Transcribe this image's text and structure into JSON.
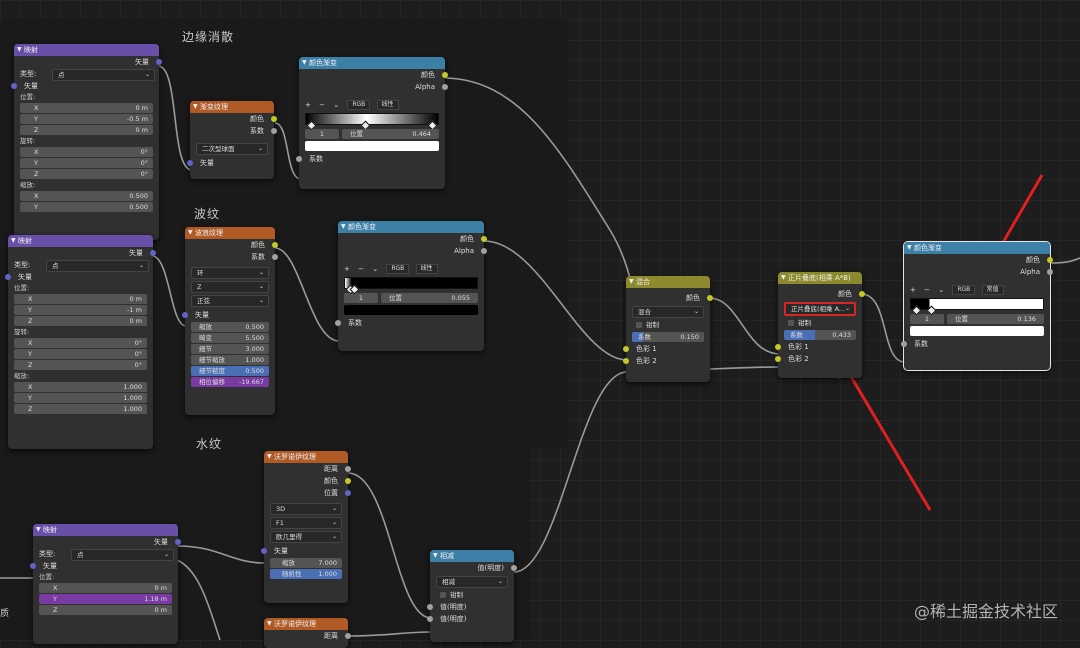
{
  "frames": [
    {
      "title": "边缘消散"
    },
    {
      "title": "波纹"
    },
    {
      "title": "水纹"
    }
  ],
  "nodes": {
    "mapping1": {
      "title": "映射",
      "out_vector": "矢量",
      "type_label": "类型:",
      "type_value": "点",
      "in_vector": "矢量",
      "loc_label": "位置:",
      "loc": [
        {
          "axis": "X",
          "value": "0 m"
        },
        {
          "axis": "Y",
          "value": "-0.5 m"
        },
        {
          "axis": "Z",
          "value": "0 m"
        }
      ],
      "rot_label": "旋转:",
      "rot": [
        {
          "axis": "X",
          "value": "0°"
        },
        {
          "axis": "Y",
          "value": "0°"
        },
        {
          "axis": "Z",
          "value": "0°"
        }
      ],
      "scale_label": "缩放:",
      "scale": [
        {
          "axis": "X",
          "value": "0.500"
        },
        {
          "axis": "Y",
          "value": "0.500"
        }
      ]
    },
    "mapping2": {
      "title": "映射",
      "out_vector": "矢量",
      "type_label": "类型:",
      "type_value": "点",
      "in_vector": "矢量",
      "loc_label": "位置:",
      "loc": [
        {
          "axis": "X",
          "value": "0 m"
        },
        {
          "axis": "Y",
          "value": "-1 m"
        },
        {
          "axis": "Z",
          "value": "0 m"
        }
      ],
      "rot_label": "旋转:",
      "rot": [
        {
          "axis": "X",
          "value": "0°"
        },
        {
          "axis": "Y",
          "value": "0°"
        },
        {
          "axis": "Z",
          "value": "0°"
        }
      ],
      "scale_label": "缩放:",
      "scale": [
        {
          "axis": "X",
          "value": "1.000"
        },
        {
          "axis": "Y",
          "value": "1.000"
        },
        {
          "axis": "Z",
          "value": "1.000"
        }
      ]
    },
    "mapping3": {
      "title": "映射",
      "out_vector": "矢量",
      "type_label": "类型:",
      "type_value": "点",
      "in_vector": "矢量",
      "loc_label": "位置:",
      "loc": [
        {
          "axis": "X",
          "value": "0 m"
        },
        {
          "axis": "Y",
          "value": "1.18 m"
        },
        {
          "axis": "Z",
          "value": "0 m"
        }
      ],
      "left_text": "质"
    },
    "gradient": {
      "title": "渐变纹理",
      "out_color": "颜色",
      "out_factor": "系数",
      "mode": "二次型球面",
      "in_vector": "矢量"
    },
    "ramp1": {
      "title": "颜色渐变",
      "out_color": "颜色",
      "out_alpha": "Alpha",
      "plus": "+",
      "minus": "−",
      "chev": "⌄",
      "color_mode": "RGB",
      "interp": "线性",
      "index": "1",
      "pos_label": "位置",
      "pos_value": "0.464",
      "in_factor": "系数"
    },
    "wave": {
      "title": "波浪纹理",
      "out_color": "颜色",
      "out_factor": "系数",
      "type": "环",
      "axis": "Z",
      "profile": "正弦",
      "in_vector": "矢量",
      "fields": [
        {
          "label": "缩放",
          "value": "0.500"
        },
        {
          "label": "畸变",
          "value": "5.500"
        },
        {
          "label": "细节",
          "value": "3.000"
        },
        {
          "label": "细节缩放",
          "value": "1.000"
        },
        {
          "label": "细节糙度",
          "value": "0.500"
        },
        {
          "label": "相位偏移",
          "value": "-19.667"
        }
      ]
    },
    "ramp2": {
      "title": "颜色渐变",
      "out_color": "颜色",
      "out_alpha": "Alpha",
      "plus": "+",
      "minus": "−",
      "chev": "⌄",
      "color_mode": "RGB",
      "interp": "线性",
      "index": "1",
      "pos_label": "位置",
      "pos_value": "0.055",
      "in_factor": "系数"
    },
    "voronoi1": {
      "title": "沃罗诺伊纹理",
      "out_distance": "距离",
      "out_color": "颜色",
      "out_position": "位置",
      "dim": "3D",
      "feature": "F1",
      "metric": "欧几里得",
      "in_vector": "矢量",
      "fields": [
        {
          "label": "缩放",
          "value": "7.000"
        },
        {
          "label": "随机性",
          "value": "1.000"
        }
      ]
    },
    "voronoi2": {
      "title": "沃罗诺伊纹理",
      "out_distance": "距离"
    },
    "subtract": {
      "title": "相减",
      "out_value": "值(明度)",
      "op": "相减",
      "clamp": "钳制",
      "in1": "值(明度)",
      "in2": "值(明度)"
    },
    "mix1": {
      "title": "混合",
      "out_color": "颜色",
      "blend": "混合",
      "clamp": "钳制",
      "factor_label": "系数",
      "factor_value": "0.150",
      "in_color1": "色彩 1",
      "in_color2": "色彩 2"
    },
    "mix2": {
      "title": "正片叠底(相乘 A*B)",
      "out_color": "颜色",
      "blend": "正片叠底(相乘 A...",
      "clamp": "钳制",
      "factor_label": "系数",
      "factor_value": "0.433",
      "in_color1": "色彩 1",
      "in_color2": "色彩 2"
    },
    "ramp3": {
      "title": "颜色渐变",
      "out_color": "颜色",
      "out_alpha": "Alpha",
      "plus": "+",
      "minus": "−",
      "chev": "⌄",
      "color_mode": "RGB",
      "interp": "常值",
      "index": "1",
      "pos_label": "位置",
      "pos_value": "0.136",
      "in_factor": "系数"
    }
  },
  "watermark": "@稀土掘金技术社区",
  "colors": {
    "socket_color": "#c7c729",
    "socket_float": "#a1a1a1",
    "socket_vector": "#6363c7",
    "header_vector": "#6a4fa8",
    "header_texture": "#b05a26",
    "header_converter": "#3c7fa7",
    "header_color": "#8c8a2c",
    "annotation_arrow": "#e02020"
  }
}
